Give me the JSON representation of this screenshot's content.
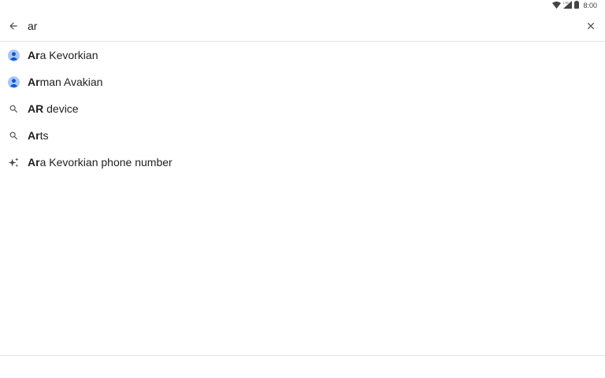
{
  "status_bar": {
    "time": "8:00",
    "network": "LTE"
  },
  "search": {
    "query": "ar",
    "back_icon": "arrow-left-icon",
    "clear_icon": "close-icon"
  },
  "suggestions": [
    {
      "icon": "contact-avatar-icon",
      "bold": "Ar",
      "rest": "a Kevorkian"
    },
    {
      "icon": "contact-avatar-icon",
      "bold": "Ar",
      "rest": "man Avakian"
    },
    {
      "icon": "search-icon",
      "bold": "AR",
      "rest": " device"
    },
    {
      "icon": "search-icon",
      "bold": "Ar",
      "rest": "ts"
    },
    {
      "icon": "sparkle-icon",
      "bold": "Ar",
      "rest": "a Kevorkian phone number"
    }
  ],
  "colors": {
    "avatar": "#a8c7fa",
    "avatar_figure": "#0b57d0",
    "icon": "#444746",
    "divider": "#e3e3e3"
  }
}
